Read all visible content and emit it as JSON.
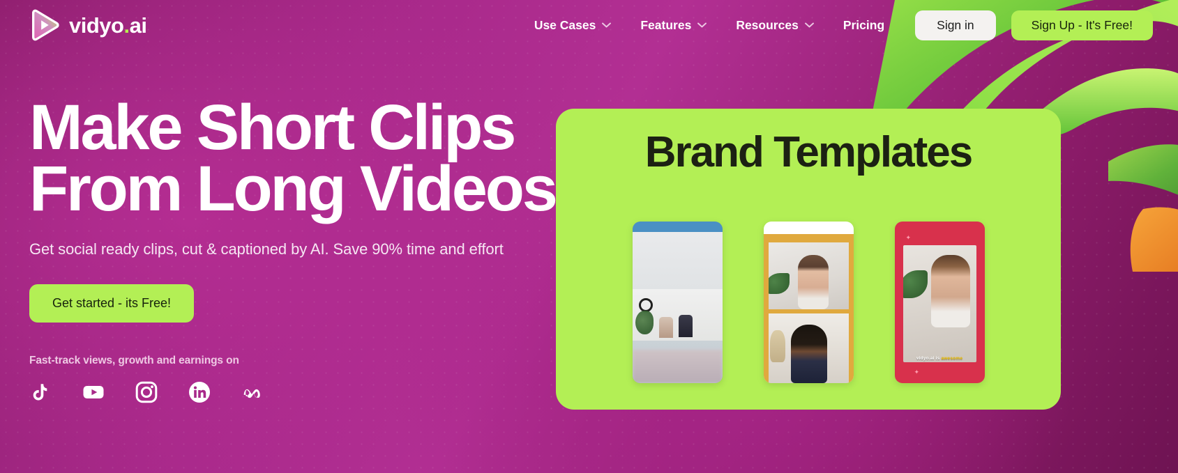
{
  "brand": {
    "name_main": "vidyo",
    "name_dot": ".",
    "name_suffix": "ai",
    "logo_icon": "play-triangle-icon"
  },
  "nav": {
    "items": [
      {
        "label": "Use Cases",
        "has_dropdown": true,
        "icon": "chevron-down-icon"
      },
      {
        "label": "Features",
        "has_dropdown": true,
        "icon": "chevron-down-icon"
      },
      {
        "label": "Resources",
        "has_dropdown": true,
        "icon": "chevron-down-icon"
      },
      {
        "label": "Pricing",
        "has_dropdown": false,
        "icon": ""
      }
    ],
    "sign_in_label": "Sign in",
    "sign_up_label": "Sign Up - It's Free!"
  },
  "hero": {
    "headline_line1": "Make Short Clips",
    "headline_line2": "From Long Videos",
    "subheadline": "Get social ready clips, cut & captioned by AI. Save 90% time and effort",
    "cta_label": "Get started - its Free!",
    "proof_text": "Fast-track views, growth and earnings on",
    "socials": [
      {
        "name": "tiktok-icon",
        "label": "TikTok"
      },
      {
        "name": "youtube-icon",
        "label": "YouTube"
      },
      {
        "name": "instagram-icon",
        "label": "Instagram"
      },
      {
        "name": "linkedin-icon",
        "label": "LinkedIn"
      },
      {
        "name": "meta-icon",
        "label": "Meta"
      }
    ]
  },
  "showcase": {
    "title": "Brand Templates",
    "phones": [
      {
        "id": "phone-blue",
        "frame_color": "#4a90c4",
        "caption": ""
      },
      {
        "id": "phone-gold",
        "frame_color": "#e0a93e",
        "caption": ""
      },
      {
        "id": "phone-red",
        "frame_color": "#d8314c",
        "caption_prefix": "vidyo.ai is ",
        "caption_highlight": "awesome"
      }
    ]
  },
  "colors": {
    "accent_green": "#b3ef55",
    "background_magenta": "#a8298a",
    "card_green": "#b3ef55",
    "dark_text": "#1c2113"
  }
}
